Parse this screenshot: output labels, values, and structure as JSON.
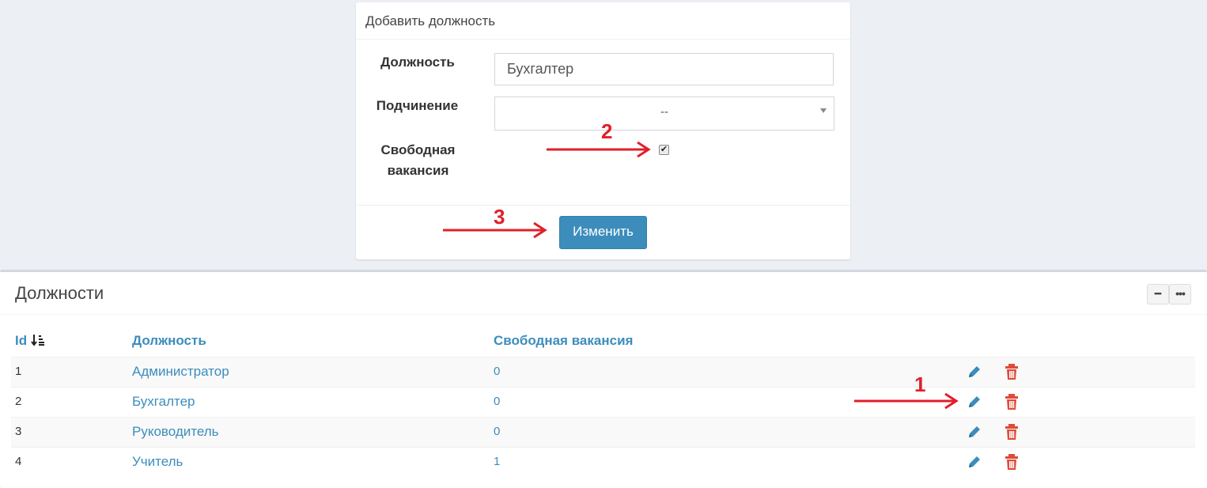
{
  "form": {
    "title": "Добавить должность",
    "position_label": "Должность",
    "position_value": "Бухгалтер",
    "subordination_label": "Подчинение",
    "subordination_value": "--",
    "vacancy_label_line1": "Свободная",
    "vacancy_label_line2": "вакансия",
    "vacancy_checked": true,
    "submit_label": "Изменить"
  },
  "table_box": {
    "title": "Должности",
    "tools": {
      "collapse_icon": "minus-icon",
      "more_icon": "ellipsis-icon"
    },
    "columns": {
      "id": "Id",
      "position": "Должность",
      "vacancy": "Свободная вакансия"
    },
    "sort_icon": "sort-amount-desc-icon",
    "rows": [
      {
        "id": "1",
        "position": "Администратор",
        "vacancy": "0"
      },
      {
        "id": "2",
        "position": "Бухгалтер",
        "vacancy": "0"
      },
      {
        "id": "3",
        "position": "Руководитель",
        "vacancy": "0"
      },
      {
        "id": "4",
        "position": "Учитель",
        "vacancy": "1"
      }
    ]
  },
  "annotations": {
    "one": "1",
    "two": "2",
    "three": "3"
  },
  "colors": {
    "primary": "#3c8dbc",
    "danger": "#dd4b39",
    "annotation": "#e0202a"
  }
}
